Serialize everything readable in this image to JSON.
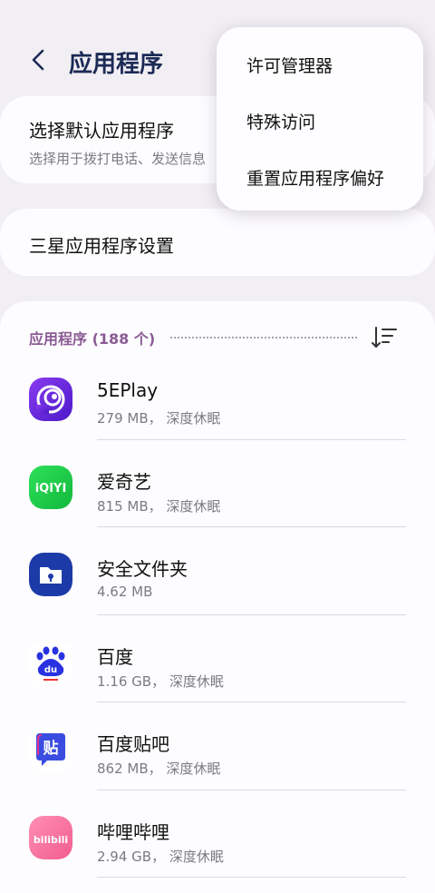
{
  "header": {
    "title": "应用程序"
  },
  "popup_menu": {
    "items": [
      {
        "label": "许可管理器"
      },
      {
        "label": "特殊访问"
      },
      {
        "label": "重置应用程序偏好"
      }
    ]
  },
  "default_apps": {
    "title": "选择默认应用程序",
    "subtitle": "选择用于拨打电话、发送信息"
  },
  "samsung_settings": {
    "title": "三星应用程序设置"
  },
  "apps_section": {
    "count_label": "应用程序 (188 个)",
    "items": [
      {
        "name": "5EPlay",
        "meta": "279 MB， 深度休眠",
        "icon": "5eplay-icon"
      },
      {
        "name": "爱奇艺",
        "meta": "815 MB， 深度休眠",
        "icon": "iqiyi-icon"
      },
      {
        "name": "安全文件夹",
        "meta": "4.62 MB",
        "icon": "secure-folder-icon"
      },
      {
        "name": "百度",
        "meta": "1.16 GB， 深度休眠",
        "icon": "baidu-icon"
      },
      {
        "name": "百度贴吧",
        "meta": "862 MB， 深度休眠",
        "icon": "baidu-tieba-icon"
      },
      {
        "name": "哔哩哔哩",
        "meta": "2.94 GB， 深度休眠",
        "icon": "bilibili-icon"
      }
    ]
  },
  "colors": {
    "title_blue": "#1b2a55",
    "section_purple": "#8a5c95",
    "background": "#f2eff4"
  }
}
